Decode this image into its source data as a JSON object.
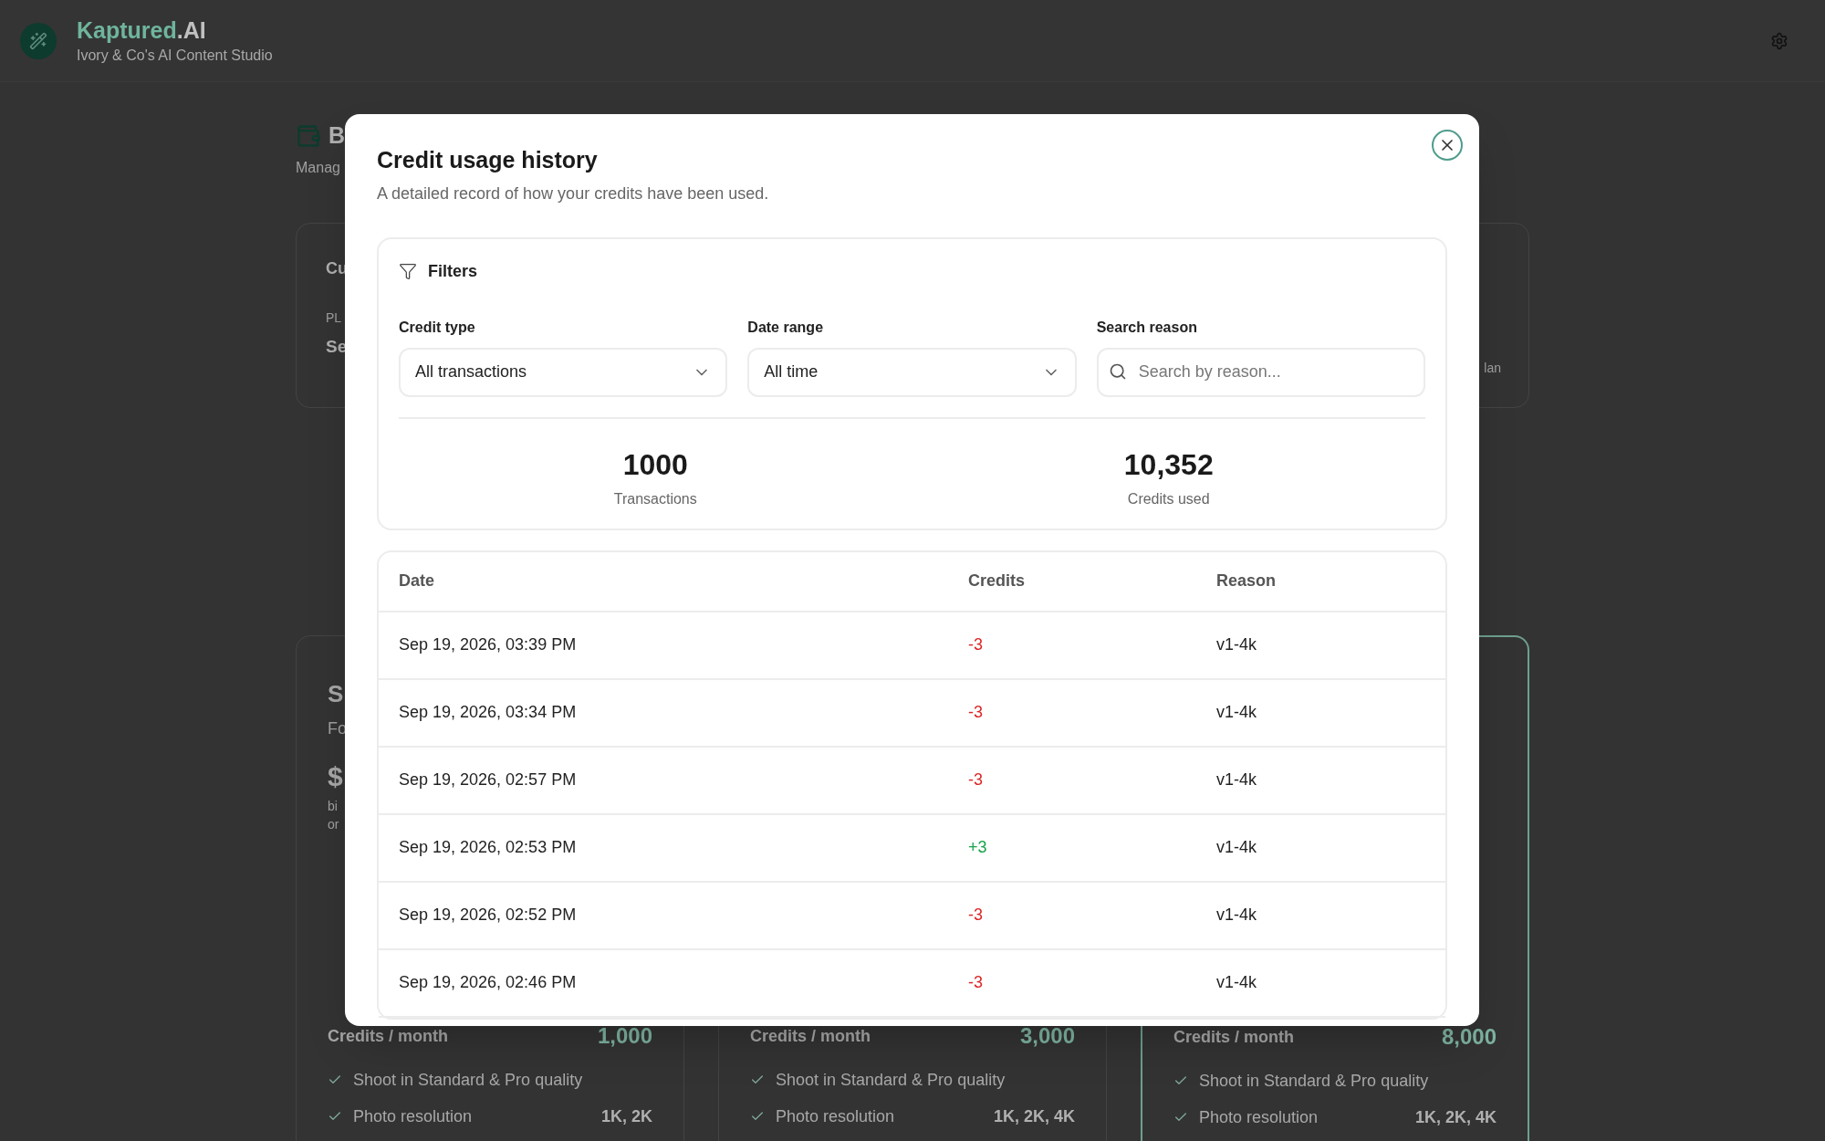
{
  "header": {
    "brand": "Kaptured",
    "brand_suffix": ".AI",
    "subtitle": "Ivory & Co's AI Content Studio"
  },
  "page": {
    "title_fragment": "B",
    "subtitle_fragment": "Manag"
  },
  "current_plan_card": {
    "title_fragment": "Cu",
    "label_fragment": "PL",
    "value_fragment": "Se",
    "note_fragment": "lan"
  },
  "plans": [
    {
      "name_fragment": "S",
      "desc_fragment": "Fo",
      "price_fragment": "$",
      "note_fragments": [
        "bi",
        "or"
      ],
      "highlighted": false,
      "credits_label": "Credits / month",
      "credits": "1,000",
      "features": [
        {
          "label": "Shoot in Standard & Pro quality"
        },
        {
          "label": "Photo resolution",
          "value": "1K, 2K"
        }
      ]
    },
    {
      "highlighted": false,
      "credits_label": "Credits / month",
      "credits": "3,000",
      "features": [
        {
          "label": "Shoot in Standard & Pro quality"
        },
        {
          "label": "Photo resolution",
          "value": "1K, 2K, 4K"
        }
      ]
    },
    {
      "highlighted": true,
      "credits_label": "Credits / month",
      "credits": "8,000",
      "features": [
        {
          "label": "Shoot in Standard & Pro quality"
        },
        {
          "label": "Photo resolution",
          "value": "1K, 2K, 4K"
        }
      ]
    }
  ],
  "modal": {
    "title": "Credit usage history",
    "subtitle": "A detailed record of how your credits have been used.",
    "filters": {
      "title": "Filters",
      "fields": [
        {
          "label": "Credit type",
          "kind": "select",
          "value": "All transactions"
        },
        {
          "label": "Date range",
          "kind": "select",
          "value": "All time"
        },
        {
          "label": "Search reason",
          "kind": "search",
          "placeholder": "Search by reason..."
        }
      ]
    },
    "stats": [
      {
        "value": "1000",
        "label": "Transactions"
      },
      {
        "value": "10,352",
        "label": "Credits used"
      }
    ],
    "table": {
      "columns": [
        "Date",
        "Credits",
        "Reason"
      ],
      "rows": [
        {
          "date": "Sep 19, 2026, 03:39 PM",
          "credits": "-3",
          "kind": "debit",
          "reason": "v1-4k"
        },
        {
          "date": "Sep 19, 2026, 03:34 PM",
          "credits": "-3",
          "kind": "debit",
          "reason": "v1-4k"
        },
        {
          "date": "Sep 19, 2026, 02:57 PM",
          "credits": "-3",
          "kind": "debit",
          "reason": "v1-4k"
        },
        {
          "date": "Sep 19, 2026, 02:53 PM",
          "credits": "+3",
          "kind": "credit",
          "reason": "v1-4k"
        },
        {
          "date": "Sep 19, 2026, 02:52 PM",
          "credits": "-3",
          "kind": "debit",
          "reason": "v1-4k"
        },
        {
          "date": "Sep 19, 2026, 02:46 PM",
          "credits": "-3",
          "kind": "debit",
          "reason": "v1-4k"
        }
      ]
    }
  }
}
